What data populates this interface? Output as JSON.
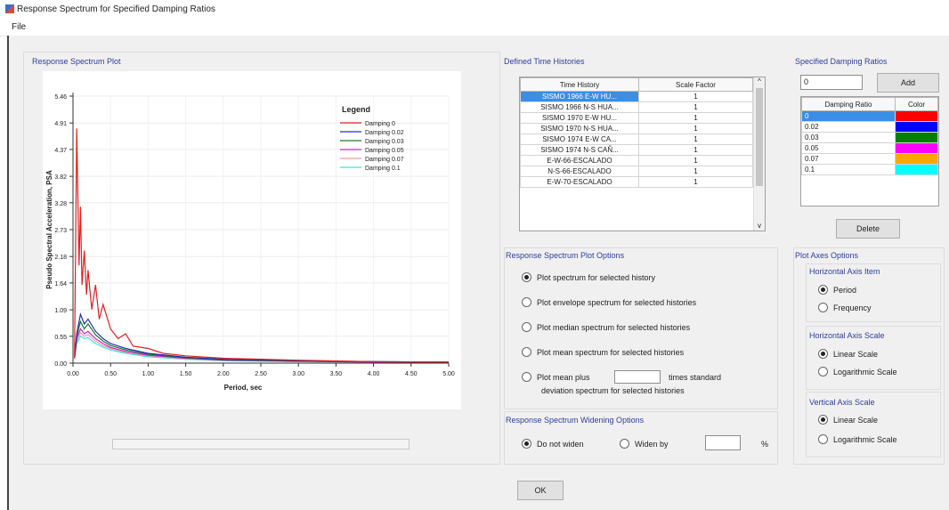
{
  "window": {
    "title": "Response Spectrum for Specified Damping Ratios"
  },
  "menu": {
    "file": "File"
  },
  "plot": {
    "group_title": "Response Spectrum Plot",
    "legend_title": "Legend",
    "ylabel": "Pseudo Spectral Acceleration, PSA",
    "xlabel": "Period, sec",
    "y_ticks": [
      "5.46",
      "4.91",
      "4.37",
      "3.82",
      "3.28",
      "2.73",
      "2.18",
      "1.64",
      "1.09",
      "0.55",
      "0.00"
    ],
    "x_ticks": [
      "0.00",
      "0.50",
      "1.00",
      "1.50",
      "2.00",
      "2.50",
      "3.00",
      "3.50",
      "4.00",
      "4.50",
      "5.00"
    ],
    "legend": [
      "Damping 0",
      "Damping 0.02",
      "Damping 0.03",
      "Damping 0.05",
      "Damping 0.07",
      "Damping 0.1"
    ]
  },
  "chart_data": {
    "type": "line",
    "xlabel": "Period, sec",
    "ylabel": "Pseudo Spectral Acceleration, PSA",
    "xlim": [
      0,
      5
    ],
    "ylim": [
      0,
      5.46
    ],
    "grid": true,
    "legend_position": "top-right",
    "series": [
      {
        "name": "Damping 0",
        "color": "#e02020",
        "x": [
          0.02,
          0.05,
          0.08,
          0.1,
          0.12,
          0.15,
          0.18,
          0.2,
          0.25,
          0.3,
          0.35,
          0.4,
          0.5,
          0.6,
          0.7,
          0.8,
          1.0,
          1.2,
          1.5,
          2.0,
          2.5,
          3.0,
          4.0,
          5.0
        ],
        "y": [
          0.1,
          4.8,
          2.0,
          3.2,
          1.6,
          2.3,
          1.4,
          1.9,
          1.1,
          1.6,
          0.9,
          1.2,
          0.7,
          0.5,
          0.6,
          0.35,
          0.3,
          0.2,
          0.15,
          0.1,
          0.08,
          0.06,
          0.03,
          0.02
        ]
      },
      {
        "name": "Damping 0.02",
        "color": "#2030b0",
        "x": [
          0.02,
          0.05,
          0.1,
          0.15,
          0.2,
          0.3,
          0.4,
          0.5,
          0.7,
          1.0,
          1.5,
          2.0,
          3.0,
          4.0,
          5.0
        ],
        "y": [
          0.1,
          0.6,
          1.0,
          0.8,
          0.9,
          0.65,
          0.5,
          0.4,
          0.3,
          0.2,
          0.12,
          0.08,
          0.05,
          0.03,
          0.02
        ]
      },
      {
        "name": "Damping 0.03",
        "color": "#1a7a2a",
        "x": [
          0.02,
          0.05,
          0.1,
          0.15,
          0.2,
          0.3,
          0.4,
          0.5,
          0.7,
          1.0,
          1.5,
          2.0,
          3.0,
          4.0,
          5.0
        ],
        "y": [
          0.1,
          0.55,
          0.85,
          0.7,
          0.8,
          0.58,
          0.45,
          0.36,
          0.27,
          0.18,
          0.11,
          0.07,
          0.04,
          0.03,
          0.02
        ]
      },
      {
        "name": "Damping 0.05",
        "color": "#d020d0",
        "x": [
          0.02,
          0.05,
          0.1,
          0.15,
          0.2,
          0.3,
          0.4,
          0.5,
          0.7,
          1.0,
          1.5,
          2.0,
          3.0,
          4.0,
          5.0
        ],
        "y": [
          0.1,
          0.5,
          0.7,
          0.6,
          0.65,
          0.5,
          0.4,
          0.32,
          0.24,
          0.16,
          0.1,
          0.06,
          0.04,
          0.02,
          0.02
        ]
      },
      {
        "name": "Damping 0.07",
        "color": "#f0a0a0",
        "x": [
          0.02,
          0.05,
          0.1,
          0.15,
          0.2,
          0.3,
          0.4,
          0.5,
          0.7,
          1.0,
          1.5,
          2.0,
          3.0,
          4.0,
          5.0
        ],
        "y": [
          0.1,
          0.45,
          0.62,
          0.55,
          0.58,
          0.45,
          0.36,
          0.3,
          0.22,
          0.15,
          0.09,
          0.06,
          0.03,
          0.02,
          0.02
        ]
      },
      {
        "name": "Damping 0.1",
        "color": "#40e0e0",
        "x": [
          0.02,
          0.05,
          0.1,
          0.15,
          0.2,
          0.3,
          0.4,
          0.5,
          0.7,
          1.0,
          1.5,
          2.0,
          3.0,
          4.0,
          5.0
        ],
        "y": [
          0.1,
          0.4,
          0.55,
          0.5,
          0.52,
          0.4,
          0.33,
          0.27,
          0.2,
          0.13,
          0.08,
          0.05,
          0.03,
          0.02,
          0.02
        ]
      }
    ]
  },
  "histories": {
    "group_title": "Defined Time Histories",
    "columns": [
      "Time History",
      "Scale Factor"
    ],
    "rows": [
      [
        "SISMO 1966 E-W HU...",
        "1"
      ],
      [
        "SISMO 1966 N-S HUA...",
        "1"
      ],
      [
        "SISMO 1970 E-W HU...",
        "1"
      ],
      [
        "SISMO 1970 N-S HUA...",
        "1"
      ],
      [
        "SISMO 1974 E-W CA...",
        "1"
      ],
      [
        "SISMO 1974 N-S CAÑ...",
        "1"
      ],
      [
        "E-W-66-ESCALADO",
        "1"
      ],
      [
        "N-S-66-ESCALADO",
        "1"
      ],
      [
        "E-W-70-ESCALADO",
        "1"
      ]
    ]
  },
  "damping": {
    "group_title": "Specified Damping Ratios",
    "input_value": "0",
    "add_label": "Add",
    "columns": [
      "Damping Ratio",
      "Color"
    ],
    "rows": [
      {
        "value": "0",
        "color": "#ff0000"
      },
      {
        "value": "0.02",
        "color": "#0000ff"
      },
      {
        "value": "0.03",
        "color": "#008000"
      },
      {
        "value": "0.05",
        "color": "#ff00ff"
      },
      {
        "value": "0.07",
        "color": "#ffa500"
      },
      {
        "value": "0.1",
        "color": "#00ffff"
      }
    ],
    "delete_label": "Delete"
  },
  "plot_options": {
    "group_title": "Response Spectrum Plot Options",
    "opt1": "Plot spectrum for selected history",
    "opt2": "Plot envelope spectrum for selected histories",
    "opt3": "Plot median spectrum for selected histories",
    "opt4": "Plot mean spectrum for selected histories",
    "opt5a": "Plot mean plus",
    "opt5b": "times standard",
    "opt5c": "deviation spectrum for selected histories"
  },
  "widening": {
    "group_title": "Response Spectrum Widening Options",
    "opt1": "Do not widen",
    "opt2": "Widen by",
    "unit": "%"
  },
  "axes": {
    "group_title": "Plot Axes Options",
    "h_item_title": "Horizontal Axis Item",
    "period": "Period",
    "frequency": "Frequency",
    "h_scale_title": "Horizontal Axis Scale",
    "h_linear": "Linear Scale",
    "h_log": "Logarithmic Scale",
    "v_scale_title": "Vertical Axis Scale",
    "v_linear": "Linear Scale",
    "v_log": "Logarithmic Scale"
  },
  "ok_label": "OK"
}
